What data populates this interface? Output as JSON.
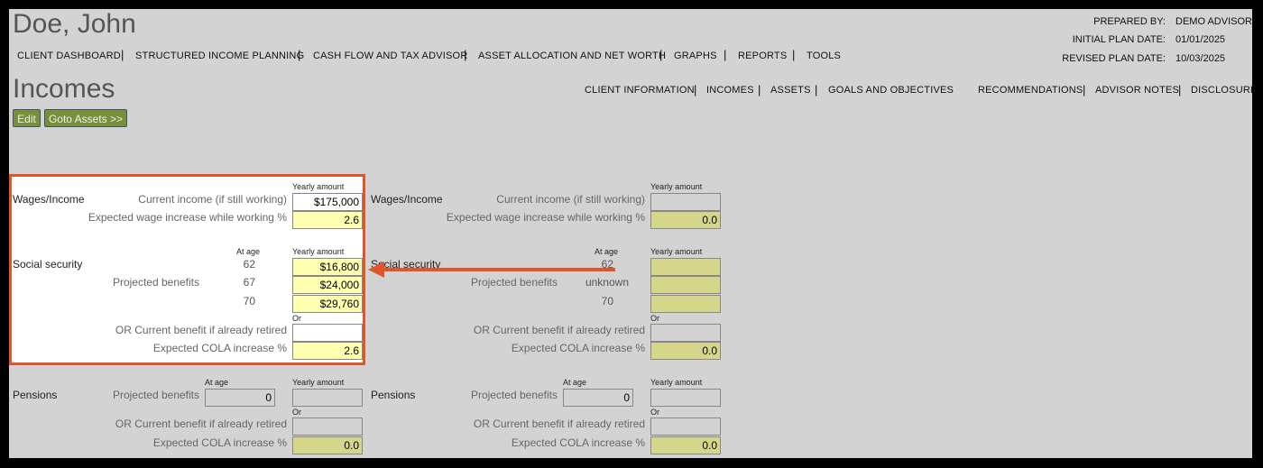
{
  "client_name": "Doe, John",
  "page_title": "Incomes",
  "main_nav": [
    "CLIENT DASHBOARD",
    "STRUCTURED INCOME PLANNING",
    "CASH FLOW AND TAX ADVISOR",
    "ASSET ALLOCATION AND NET WORTH",
    "GRAPHS",
    "REPORTS",
    "TOOLS"
  ],
  "meta": {
    "prepared_by_label": "PREPARED BY:",
    "prepared_by_value": "DEMO ADVISOR",
    "initial_label": "INITIAL PLAN DATE:",
    "initial_value": "01/01/2025",
    "revised_label": "REVISED PLAN DATE:",
    "revised_value": "10/03/2025"
  },
  "sub_nav": [
    "CLIENT INFORMATION",
    "INCOMES",
    "ASSETS",
    "GOALS AND OBJECTIVES",
    "RECOMMENDATIONS",
    "ADVISOR NOTES",
    "DISCLOSURE"
  ],
  "buttons": {
    "edit": "Edit",
    "goto_assets": "Goto Assets >>"
  },
  "labels": {
    "yearly_amount": "Yearly amount",
    "at_age": "At age",
    "or": "Or",
    "wages_income": "Wages/Income",
    "current_income": "Current income (if still working)",
    "expected_wage_increase": "Expected wage increase while working %",
    "social_security": "Social security",
    "projected_benefits": "Projected benefits",
    "or_current_benefit": "OR Current benefit if already retired",
    "expected_cola": "Expected COLA increase %",
    "pensions": "Pensions"
  },
  "client": {
    "current_income": "$175,000",
    "wage_increase": "2.6",
    "ss_ages": [
      "62",
      "67",
      "70"
    ],
    "ss_amounts": [
      "$16,800",
      "$24,000",
      "$29,760"
    ],
    "ss_current_benefit": "",
    "ss_cola": "2.6",
    "pension_age": "0",
    "pension_amount": "",
    "pension_current_benefit": "",
    "pension_cola": "0.0"
  },
  "spouse": {
    "current_income": "",
    "wage_increase": "0.0",
    "ss_ages": [
      "62",
      "unknown",
      "70"
    ],
    "ss_amounts": [
      "",
      "",
      ""
    ],
    "ss_current_benefit": "",
    "ss_cola": "0.0",
    "pension_age": "0",
    "pension_amount": "",
    "pension_current_benefit": "",
    "pension_cola": "0.0"
  },
  "colors": {
    "highlight": "#e0552c",
    "button": "#7a8f3a",
    "panel": "#d3d3d3"
  }
}
